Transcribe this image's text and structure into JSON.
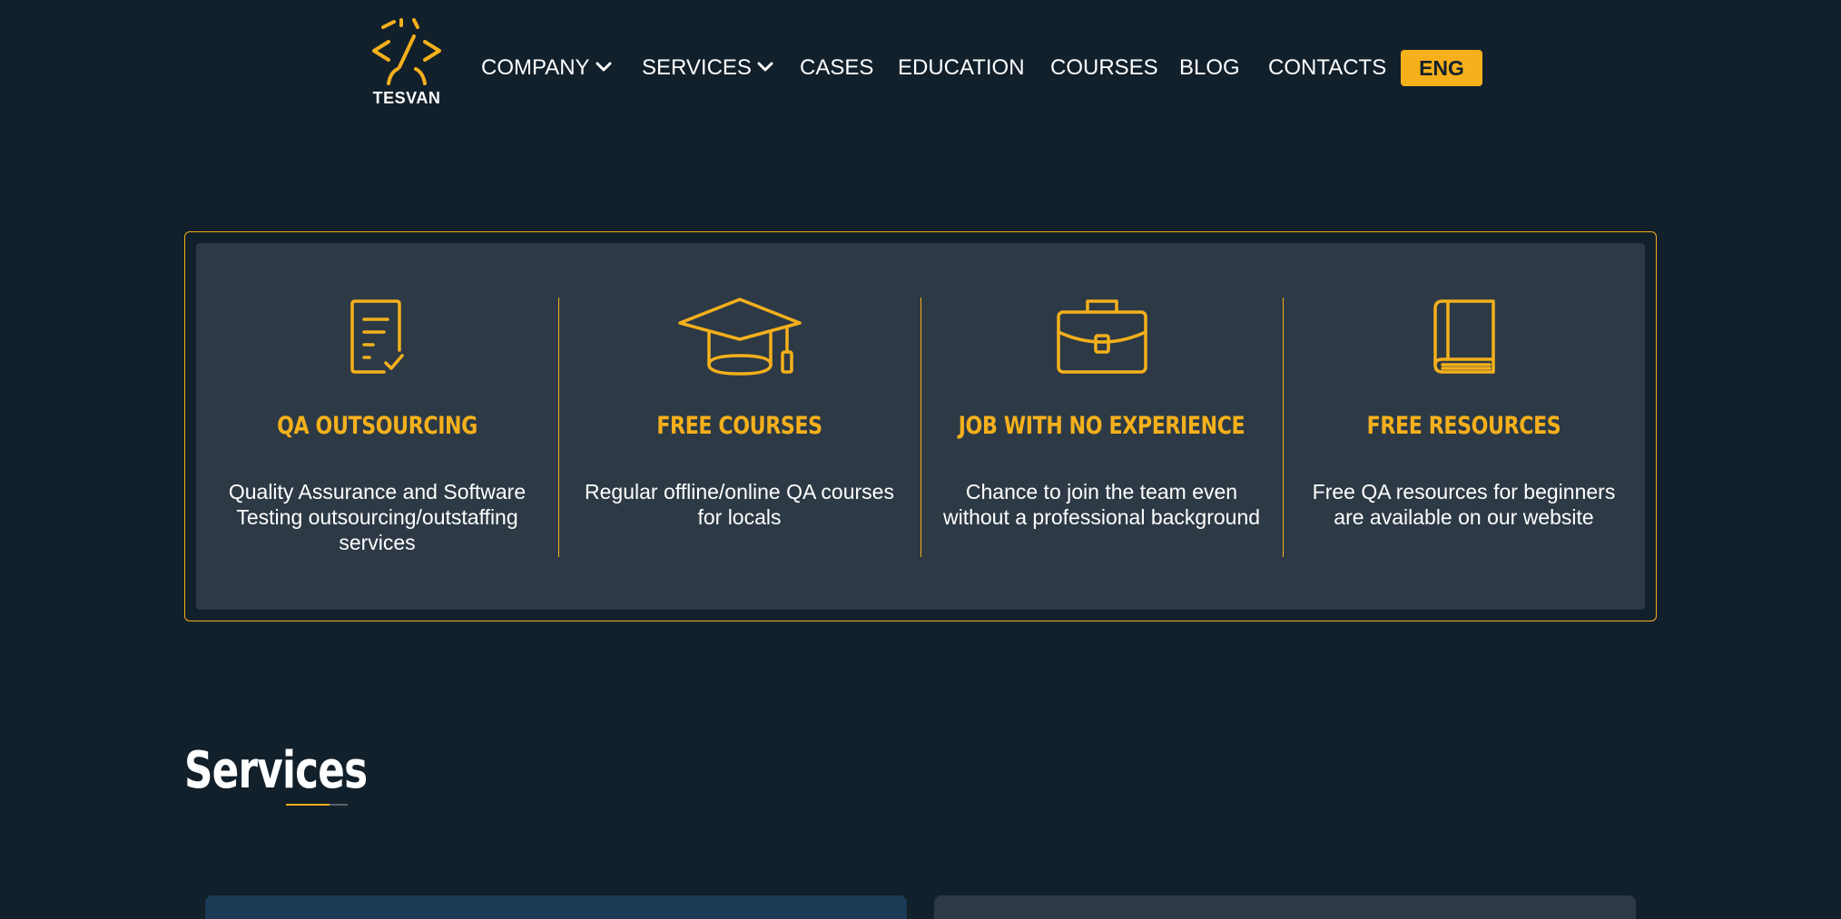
{
  "header": {
    "logo_text": "TESVAN",
    "nav": [
      {
        "label": "COMPANY",
        "has_dropdown": true
      },
      {
        "label": "SERVICES",
        "has_dropdown": true
      },
      {
        "label": "CASES",
        "has_dropdown": false
      },
      {
        "label": "EDUCATION",
        "has_dropdown": false
      },
      {
        "label": "COURSES",
        "has_dropdown": false
      },
      {
        "label": "BLOG",
        "has_dropdown": false
      },
      {
        "label": "CONTACTS",
        "has_dropdown": false
      }
    ],
    "language_button": "ENG"
  },
  "features": [
    {
      "icon": "document-check-icon",
      "title": "QA OUTSOURCING",
      "description": "Quality Assurance and Software Testing outsourcing/outstaffing services"
    },
    {
      "icon": "graduation-cap-icon",
      "title": "FREE COURSES",
      "description": "Regular offline/online QA courses for locals"
    },
    {
      "icon": "briefcase-icon",
      "title": "JOB WITH NO EXPERIENCE",
      "description": "Chance to join the team even without a professional background"
    },
    {
      "icon": "book-icon",
      "title": "FREE RESOURCES",
      "description": "Free QA resources for beginners are available on our website"
    }
  ],
  "services_section": {
    "title": "Services"
  },
  "colors": {
    "background": "#12202b",
    "panel": "#2d3a45",
    "accent": "#f5b01c",
    "text": "#ffffff",
    "card_primary": "#1b3a55",
    "card_secondary": "#2d3a45"
  }
}
